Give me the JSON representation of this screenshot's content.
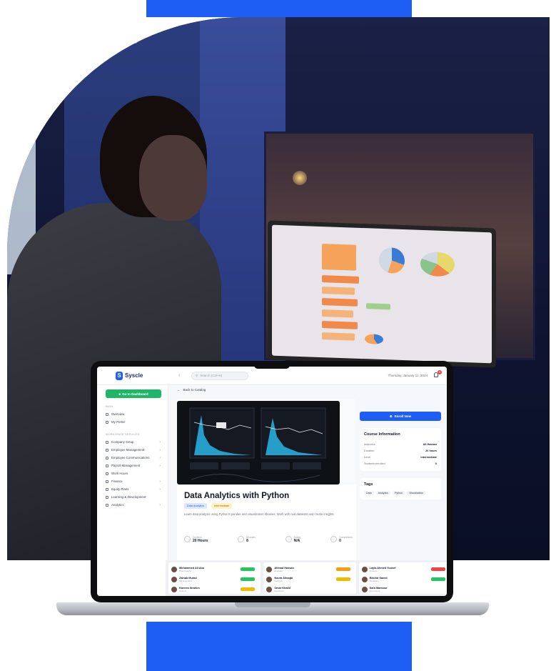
{
  "colors": {
    "accent_blue": "#1f5ef5",
    "go_green": "#1fb767",
    "category_tag_bg": "#dbe7ff",
    "level_tag_bg": "#fff1c2"
  },
  "app": {
    "logo_text": "Syscle",
    "search_placeholder": "Search (Ctrl+K)",
    "date_text": "Thursday, January 11, 2024",
    "notification_count": "3"
  },
  "sidebar": {
    "go_button_label": "Go to Dashboard",
    "section_main": "MAIN",
    "main_items": [
      "Overview",
      "My Portal"
    ],
    "section_workspace": "WORKSPACE SERVICES",
    "workspace_items": [
      {
        "label": "Company Setup",
        "has_children": true
      },
      {
        "label": "Employee Management",
        "has_children": true
      },
      {
        "label": "Employee Communications",
        "has_children": true
      },
      {
        "label": "Payroll Management",
        "has_children": true
      },
      {
        "label": "Work Hours",
        "has_children": false
      },
      {
        "label": "Finance",
        "has_children": true
      },
      {
        "label": "Equity Plans",
        "has_children": true
      },
      {
        "label": "Learning & Development",
        "has_children": false
      },
      {
        "label": "Analytics",
        "has_children": true
      }
    ]
  },
  "main": {
    "back_label": "Back to Catalog",
    "course": {
      "title": "Data Analytics with Python",
      "category_tag": "Data Analytics",
      "level_tag": "Intermediate",
      "description": "Learn data analysis using Python's pandas and visualization libraries. Work with real datasets and create insights.",
      "stats": [
        {
          "label": "Duration",
          "value": "20 Hours"
        },
        {
          "label": "Modules",
          "value": "8"
        },
        {
          "label": "Rating",
          "value": "N/A"
        },
        {
          "label": "Completions",
          "value": "0"
        }
      ]
    },
    "enroll_label": "Enroll Now",
    "course_info": {
      "title": "Course Information",
      "rows": [
        {
          "label": "Instructor",
          "value": "Ali Hassan"
        },
        {
          "label": "Duration",
          "value": "20 hours"
        },
        {
          "label": "Level",
          "value": "Intermediate"
        },
        {
          "label": "Students enrolled",
          "value": "0"
        }
      ]
    },
    "tags_panel": {
      "title": "Tags",
      "tags": [
        "Data",
        "Analytics",
        "Python",
        "Visualization"
      ]
    }
  },
  "people_cards": [
    {
      "rows": [
        {
          "name": "Mohammed Ali Abu",
          "role": "Data Analyst",
          "pill": "#22c55e"
        },
        {
          "name": "Zainab Murad",
          "role": "HR Executive",
          "pill": "#22c55e"
        },
        {
          "name": "Kareem Ibrahim",
          "role": "Analyst",
          "pill": "#f5b800"
        }
      ]
    },
    {
      "rows": [
        {
          "name": "Ahmad Hassan",
          "role": "Engineer",
          "pill": "#f59e0b"
        },
        {
          "name": "Noura Alnaqbi",
          "role": "Designer",
          "pill": "#f5b800"
        },
        {
          "name": "Omar Khalid",
          "role": "Developer",
          "pill": "#ffffff"
        }
      ]
    },
    {
      "rows": [
        {
          "name": "Layla Ahmed Yousef",
          "role": "Finance",
          "pill": "#ef4444"
        },
        {
          "name": "Rashid Saeed",
          "role": "Marketing",
          "pill": "#22c55e"
        },
        {
          "name": "Sara Mansour",
          "role": "Operations",
          "pill": "#ffffff"
        }
      ]
    }
  ]
}
